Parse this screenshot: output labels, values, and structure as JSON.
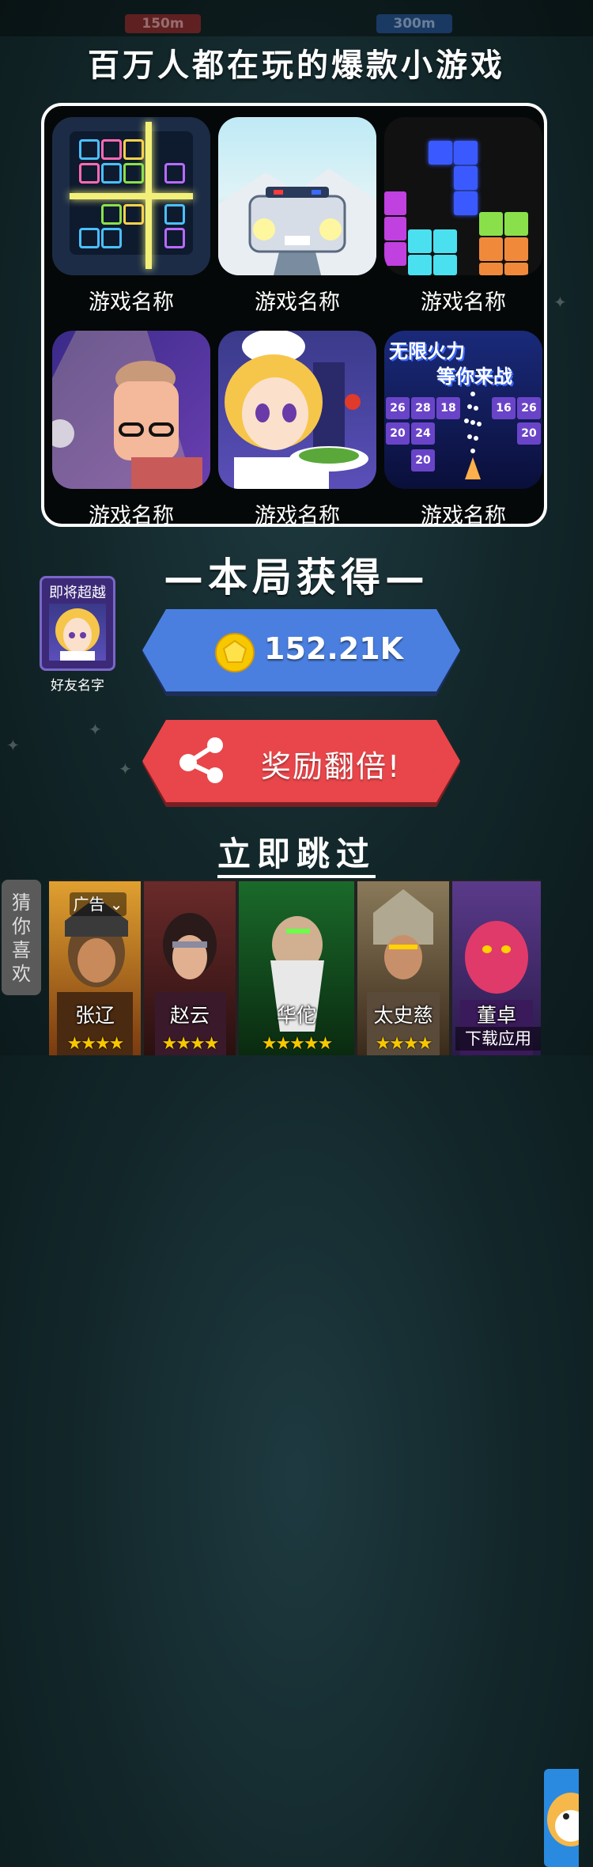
{
  "top_bar": {
    "left_distance": "150m",
    "right_distance": "300m"
  },
  "headline": "百万人都在玩的爆款小游戏",
  "games": [
    {
      "name": "游戏名称"
    },
    {
      "name": "游戏名称"
    },
    {
      "name": "游戏名称"
    },
    {
      "name": "游戏名称"
    },
    {
      "name": "游戏名称"
    },
    {
      "name": "游戏名称"
    }
  ],
  "game6_banner": {
    "line1": "无限火力",
    "line2": "等你来战",
    "numbers": [
      "26",
      "28",
      "18",
      "16",
      "26",
      "20",
      "24",
      "20",
      "20"
    ]
  },
  "reward": {
    "title": "—本局获得—",
    "coin_value": "152.21K",
    "double_label": "奖励翻倍!"
  },
  "friend_card": {
    "title": "即将超越",
    "name": "好友名字"
  },
  "skip_label": "立即跳过",
  "ad_strip": {
    "guess_label": "猜你喜欢",
    "ad_tag": "广告",
    "download_label": "下载应用",
    "heroes": [
      {
        "name": "张辽",
        "stars": "★★★★"
      },
      {
        "name": "赵云",
        "stars": "★★★★"
      },
      {
        "name": "华佗",
        "stars": "★★★★★"
      },
      {
        "name": "太史慈",
        "stars": "★★★★"
      },
      {
        "name": "董卓",
        "stars": ""
      }
    ]
  },
  "colors": {
    "blue_button": "#4a7fe0",
    "red_button": "#e8464a",
    "coin": "#f7c800",
    "panel_border": "#ffffff"
  }
}
